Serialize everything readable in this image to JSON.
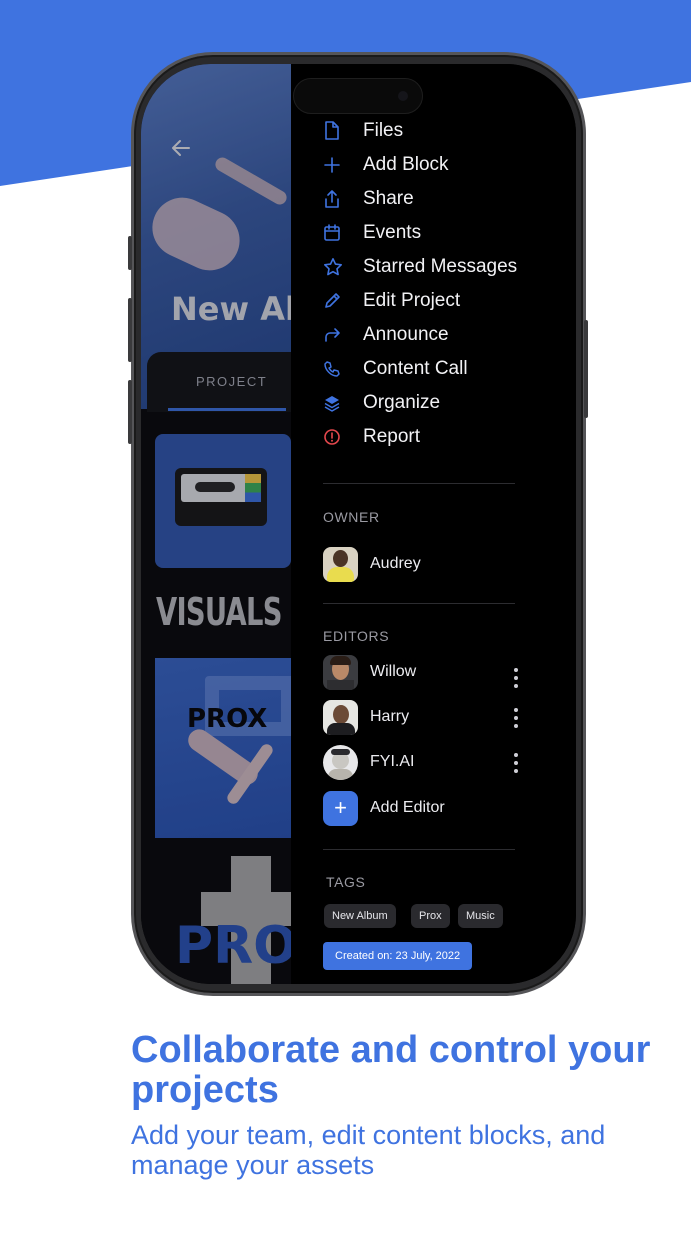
{
  "colors": {
    "accent": "#3f73e0",
    "drawer_bg": "#000000",
    "report": "#e5484d"
  },
  "project": {
    "title": "New All",
    "tab": "PROJECT",
    "section_heading": "VISUALS",
    "thumb_text": "PROX",
    "poster_text": "PRO"
  },
  "menu": {
    "items": [
      {
        "icon": "file-icon",
        "label": "Files"
      },
      {
        "icon": "plus-icon",
        "label": "Add Block"
      },
      {
        "icon": "share-icon",
        "label": "Share"
      },
      {
        "icon": "calendar-icon",
        "label": "Events"
      },
      {
        "icon": "star-icon",
        "label": "Starred Messages"
      },
      {
        "icon": "pencil-icon",
        "label": "Edit Project"
      },
      {
        "icon": "forward-arrow-icon",
        "label": "Announce"
      },
      {
        "icon": "phone-icon",
        "label": "Content Call"
      },
      {
        "icon": "layers-icon",
        "label": "Organize"
      },
      {
        "icon": "alert-circle-icon",
        "label": "Report"
      }
    ]
  },
  "owner": {
    "label": "OWNER",
    "name": "Audrey"
  },
  "editors": {
    "label": "EDITORS",
    "people": [
      {
        "name": "Willow"
      },
      {
        "name": "Harry"
      },
      {
        "name": "FYI.AI"
      }
    ],
    "add_label": "Add Editor"
  },
  "tags": {
    "label": "TAGS",
    "items": [
      "New Album",
      "Prox",
      "Music"
    ],
    "created": "Created on: 23 July, 2022"
  },
  "marketing": {
    "headline": "Collaborate and control your projects",
    "subline": "Add your team, edit content blocks, and manage your assets"
  }
}
